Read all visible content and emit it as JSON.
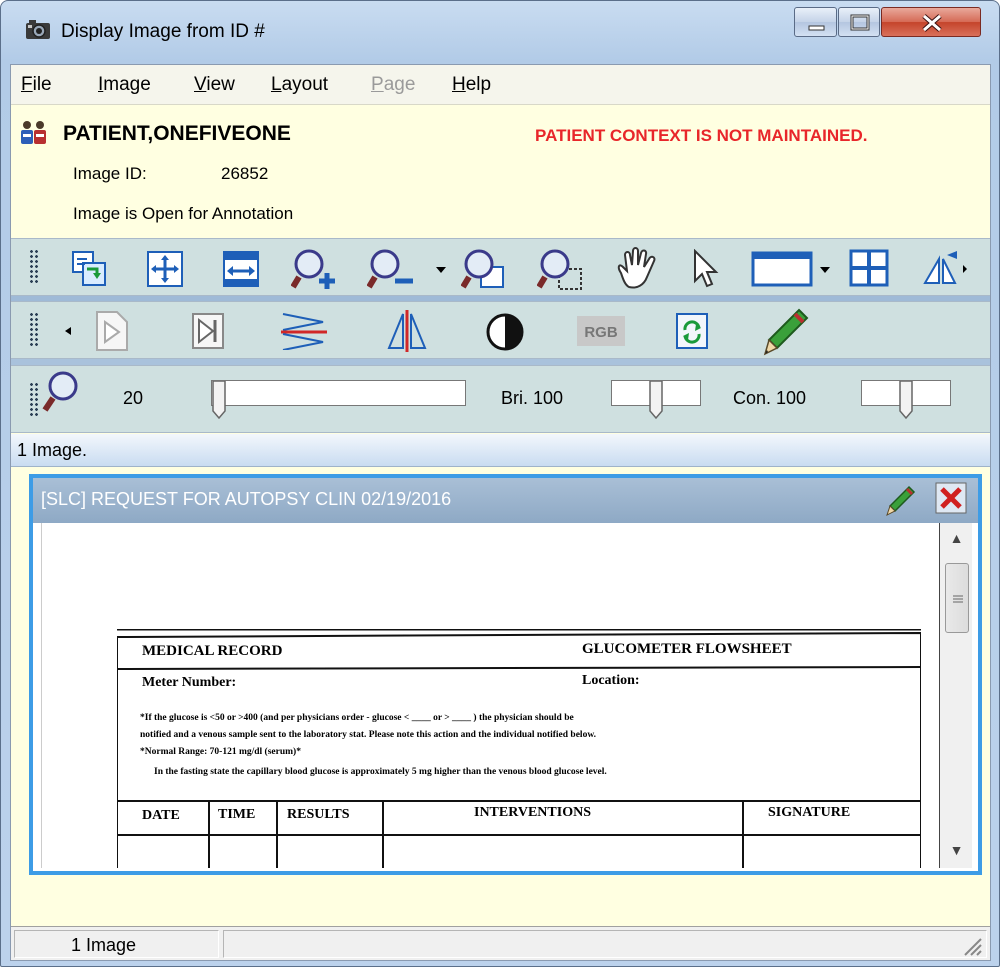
{
  "window": {
    "title": "Display Image from ID #"
  },
  "menu": [
    {
      "label": "File",
      "ul": "F",
      "rest": "ile"
    },
    {
      "label": "Image",
      "ul": "I",
      "rest": "mage"
    },
    {
      "label": "View",
      "ul": "V",
      "rest": "iew"
    },
    {
      "label": "Layout",
      "ul": "L",
      "rest": "ayout"
    },
    {
      "label": "Page",
      "ul": "P",
      "rest": "age"
    },
    {
      "label": "Help",
      "ul": "H",
      "rest": "elp"
    }
  ],
  "patient": {
    "name": "PATIENT,ONEFIVEONE",
    "warning": "PATIENT CONTEXT IS NOT MAINTAINED.",
    "image_id_label": "Image ID:",
    "image_id": "26852",
    "annotation_status": "Image is Open for Annotation"
  },
  "controls": {
    "zoom_value": "20",
    "brightness_label": "Bri. 100",
    "contrast_label": "Con. 100",
    "zoom_level": 0.0,
    "brightness_level": 0.5,
    "contrast_level": 0.5
  },
  "status_line": "1 Image.",
  "viewer": {
    "title": "[SLC] REQUEST FOR AUTOPSY CLIN 02/19/2016"
  },
  "document": {
    "header_left": "MEDICAL RECORD",
    "header_right": "GLUCOMETER FLOWSHEET",
    "meter_label": "Meter Number:",
    "location_label": "Location:",
    "line1": "*If the glucose is <50 or >400 (and per physicians order - glucose < ____ or > ____ ) the physician should be",
    "line2": "notified and a venous sample sent to the laboratory stat.  Please note this action and the individual notified below.",
    "line3": "*Normal Range: 70-121 mg/dl (serum)*",
    "line4": "In the fasting state the capillary blood glucose is approximately 5 mg higher than the venous blood glucose level.",
    "columns": [
      "DATE",
      "TIME",
      "RESULTS",
      "INTERVENTIONS",
      "SIGNATURE"
    ]
  },
  "bottom_status": {
    "pane1": "1 Image"
  },
  "colors": {
    "warning": "#e8262a",
    "viewer_border": "#3d9ce6",
    "panel_bg": "#ffffe1"
  }
}
